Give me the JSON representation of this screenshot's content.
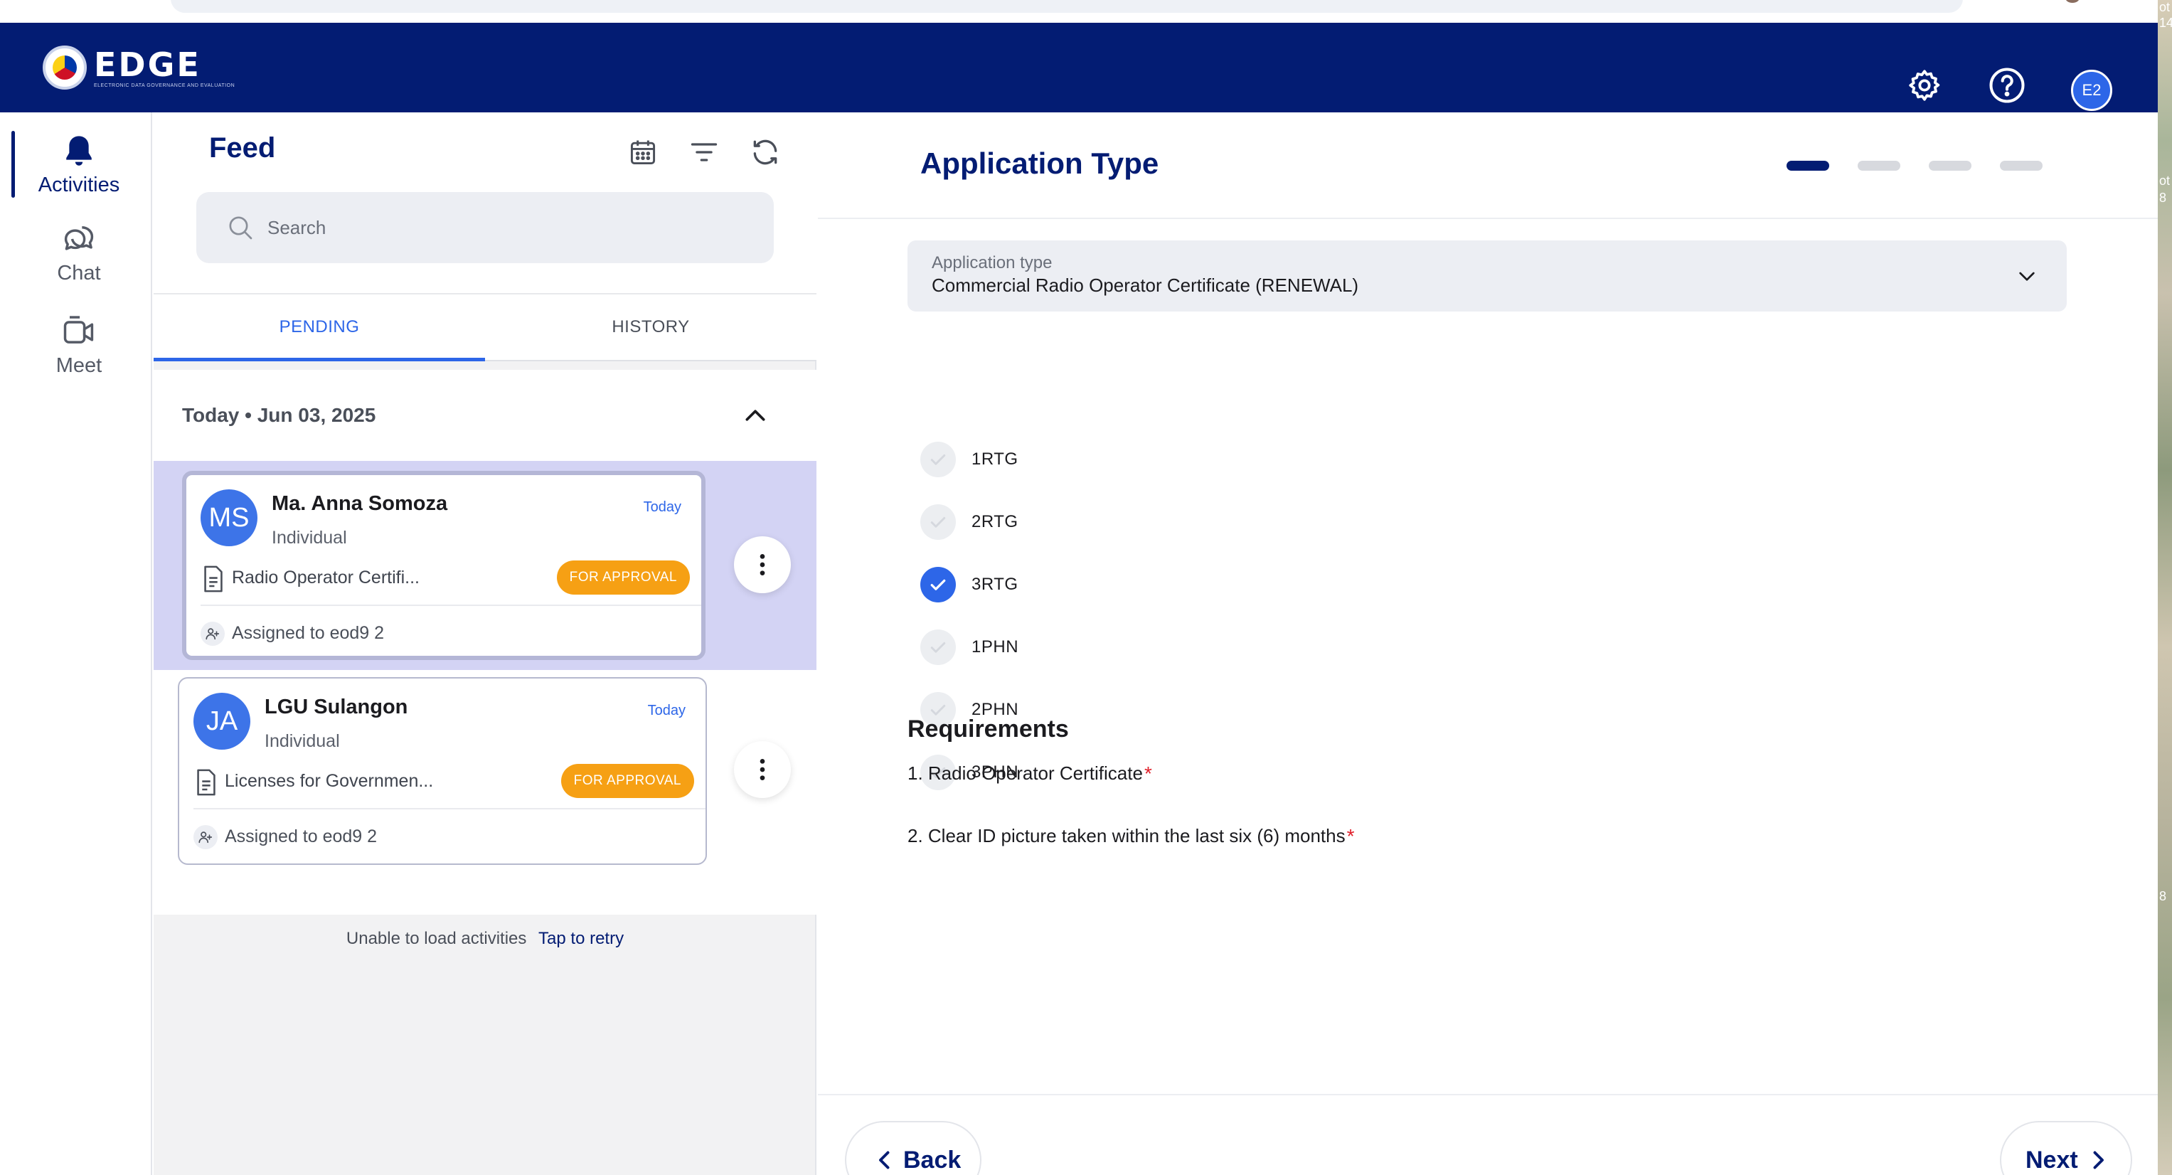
{
  "app": {
    "logo_text": "EDGE",
    "logo_subtitle": "ELECTRONIC DATA GOVERNANCE AND EVALUATION",
    "avatar_initials": "E2",
    "brand_color": "#031c73",
    "accent_color": "#2d66e8"
  },
  "header_icons": [
    "gear-icon",
    "help-icon"
  ],
  "rail": {
    "items": [
      {
        "label": "Activities",
        "icon": "bell-icon",
        "active": true
      },
      {
        "label": "Chat",
        "icon": "chat-icon",
        "active": false
      },
      {
        "label": "Meet",
        "icon": "video-icon",
        "active": false
      }
    ]
  },
  "feed": {
    "title": "Feed",
    "tools": [
      "calendar-icon",
      "filter-icon",
      "refresh-icon"
    ],
    "search_placeholder": "Search",
    "tabs": [
      {
        "label": "PENDING",
        "active": true
      },
      {
        "label": "HISTORY",
        "active": false
      }
    ],
    "date_group": "Today • Jun 03, 2025",
    "activities": [
      {
        "initials": "MS",
        "name": "Ma. Anna Somoza",
        "type": "Individual",
        "when": "Today",
        "document": "Radio Operator Certifi...",
        "status": "FOR APPROVAL",
        "assigned": "Assigned to eod9 2",
        "selected": true
      },
      {
        "initials": "JA",
        "name": "LGU Sulangon",
        "type": "Individual",
        "when": "Today",
        "document": "Licenses for Governmen...",
        "status": "FOR APPROVAL",
        "assigned": "Assigned to eod9 2",
        "selected": false
      }
    ],
    "error_text": "Unable to load activities",
    "retry_label": "Tap to retry"
  },
  "form": {
    "title": "Application Type",
    "steps_total": 4,
    "step_current": 1,
    "select_label": "Application type",
    "select_value": "Commercial Radio Operator Certificate (RENEWAL)",
    "options": [
      {
        "label": "1RTG",
        "checked": false
      },
      {
        "label": "2RTG",
        "checked": false
      },
      {
        "label": "3RTG",
        "checked": true
      },
      {
        "label": "1PHN",
        "checked": false
      },
      {
        "label": "2PHN",
        "checked": false
      },
      {
        "label": "3PHN",
        "checked": false
      }
    ],
    "requirements_heading": "Requirements",
    "requirements": [
      {
        "text": "1. Radio Operator Certificate",
        "required": "*"
      },
      {
        "text": "2. Clear ID picture taken within the last six (6) months",
        "required": "*"
      }
    ],
    "back_label": "Back",
    "next_label": "Next"
  },
  "desktop_sliver_text": [
    "ot",
    "14",
    "ot",
    "8",
    "8"
  ]
}
